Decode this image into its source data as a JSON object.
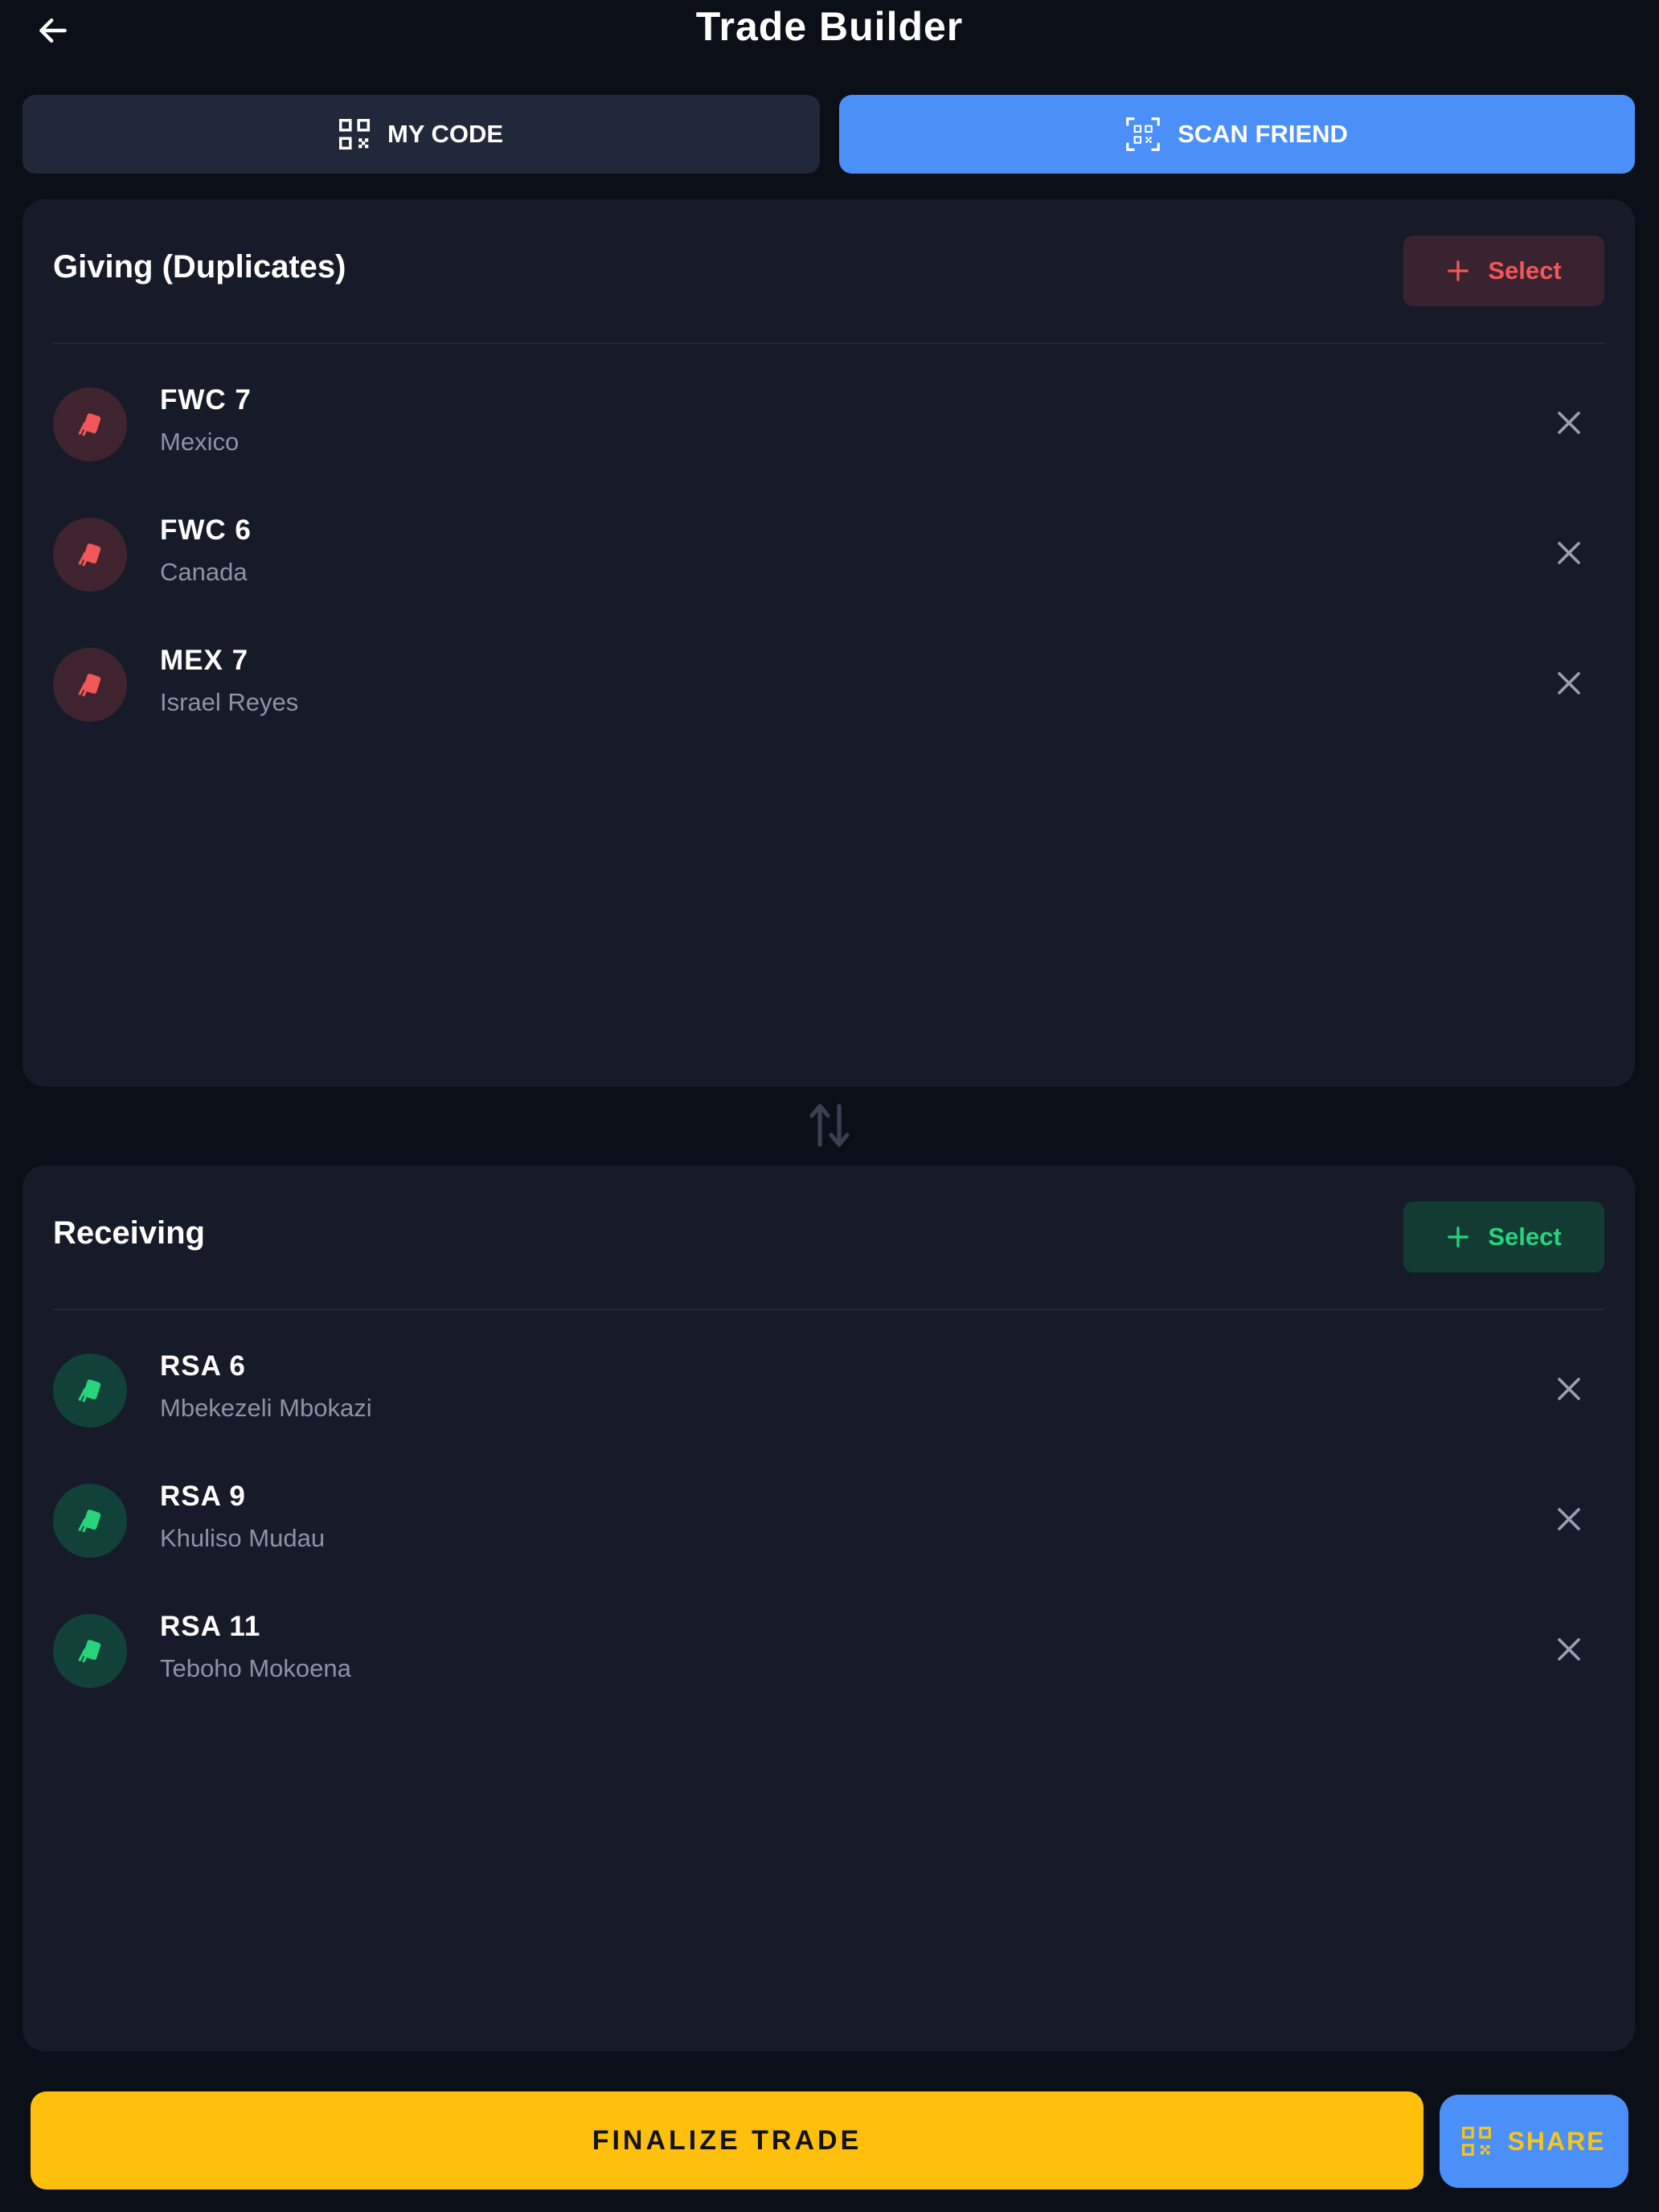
{
  "header": {
    "title": "Trade Builder",
    "back_icon": "arrow-left-icon"
  },
  "top_buttons": {
    "my_code_label": "MY CODE",
    "scan_friend_label": "SCAN FRIEND"
  },
  "giving": {
    "title": "Giving (Duplicates)",
    "select_label": "Select",
    "accent": "#f25757",
    "items": [
      {
        "code": "FWC 7",
        "name": "Mexico"
      },
      {
        "code": "FWC 6",
        "name": "Canada"
      },
      {
        "code": "MEX 7",
        "name": "Israel Reyes"
      }
    ]
  },
  "receiving": {
    "title": "Receiving",
    "select_label": "Select",
    "accent": "#27d47c",
    "items": [
      {
        "code": "RSA 6",
        "name": "Mbekezeli Mbokazi"
      },
      {
        "code": "RSA 9",
        "name": "Khuliso Mudau"
      },
      {
        "code": "RSA 11",
        "name": "Teboho Mokoena"
      }
    ]
  },
  "footer": {
    "finalize_label": "FINALIZE TRADE",
    "share_label": "SHARE"
  },
  "colors": {
    "background": "#0b0f17",
    "panel": "#171b29",
    "primary_blue": "#4b8ff9",
    "finalize_yellow": "#fec00c"
  }
}
